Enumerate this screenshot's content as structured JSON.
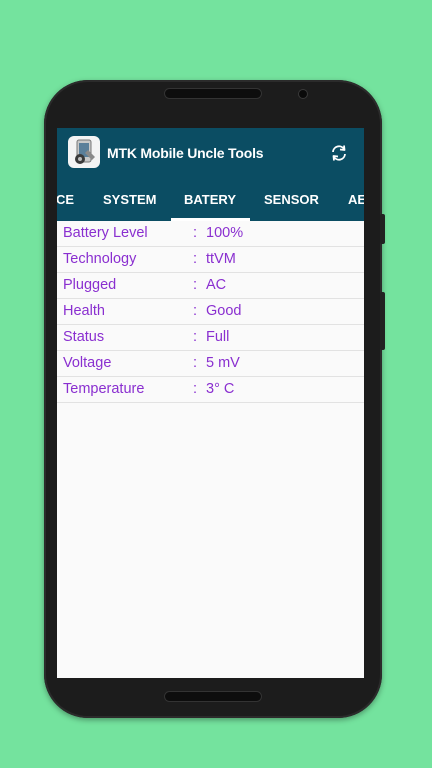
{
  "app": {
    "title": "MTK Mobile Uncle Tools"
  },
  "icons": {
    "logo": "app-logo-icon",
    "refresh": "refresh-icon"
  },
  "tabs": [
    {
      "label": "CE",
      "selected": false
    },
    {
      "label": "SYSTEM",
      "selected": false
    },
    {
      "label": "BATERY",
      "selected": true
    },
    {
      "label": "SENSOR",
      "selected": false
    },
    {
      "label": "AE",
      "selected": false
    }
  ],
  "battery": {
    "separator": ":",
    "rows": [
      {
        "label": "Battery Level",
        "value": "100%"
      },
      {
        "label": "Technology",
        "value": "ttVM"
      },
      {
        "label": "Plugged",
        "value": "AC"
      },
      {
        "label": "Health",
        "value": "Good"
      },
      {
        "label": "Status",
        "value": "Full"
      },
      {
        "label": "Voltage",
        "value": "5 mV"
      },
      {
        "label": "Temperature",
        "value": "3° C"
      }
    ]
  },
  "colors": {
    "background": "#74e39e",
    "toolbar": "#0b4d63",
    "text_accent": "#8a2fd0"
  }
}
